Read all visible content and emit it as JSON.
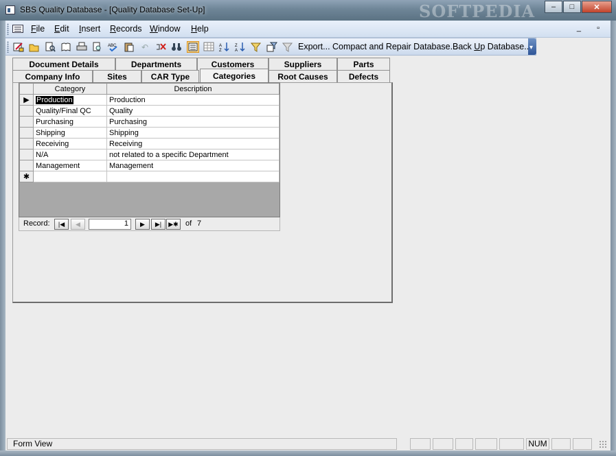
{
  "window": {
    "title": "SBS Quality Database - [Quality Database Set-Up]",
    "watermark": "SOFTPEDIA",
    "buttons": {
      "minimize": "–",
      "maximize": "□",
      "close": "✕"
    },
    "mdi_controls": "_ ▫"
  },
  "menubar": {
    "items": [
      {
        "label": "File",
        "accel": "F",
        "rest": "ile"
      },
      {
        "label": "Edit",
        "accel": "E",
        "rest": "dit"
      },
      {
        "label": "Insert",
        "accel": "I",
        "rest": "nsert"
      },
      {
        "label": "Records",
        "accel": "R",
        "rest": "ecords"
      },
      {
        "label": "Window",
        "accel": "W",
        "rest": "indow"
      },
      {
        "label": "Help",
        "accel": "H",
        "rest": "elp"
      }
    ]
  },
  "toolbar": {
    "icons": [
      "design-view-icon",
      "open-icon",
      "search-file-icon",
      "save-icon",
      "print-icon",
      "print-preview-icon",
      "spelling-icon",
      "paste-icon",
      "undo-icon",
      "delete-record-icon",
      "find-icon",
      "form-view-icon",
      "datasheet-view-icon",
      "sort-ascending-icon",
      "sort-descending-icon",
      "filter-by-selection-icon",
      "filter-by-form-icon",
      "apply-filter-icon"
    ],
    "export_label": "Export...",
    "compact_label": "Compact and Repair Database...",
    "backup_prefix": "Back",
    "backup_rest": " Up Database...",
    "backup_accel": "U"
  },
  "tabs": {
    "row1": [
      "Document Details",
      "Departments",
      "Customers",
      "Suppliers",
      "Parts"
    ],
    "row2": [
      "Company Info",
      "Sites",
      "CAR Type",
      "Categories",
      "Root Causes",
      "Defects"
    ],
    "selected": "Categories"
  },
  "datasheet": {
    "columns": [
      "Category",
      "Description"
    ],
    "rows": [
      {
        "category": "Production",
        "description": "Production"
      },
      {
        "category": "Quality/Final QC",
        "description": "Quality"
      },
      {
        "category": "Purchasing",
        "description": "Purchasing"
      },
      {
        "category": "Shipping",
        "description": "Shipping"
      },
      {
        "category": "Receiving",
        "description": "Receiving"
      },
      {
        "category": "N/A",
        "description": "not related to a specific Department"
      },
      {
        "category": "Management",
        "description": "Management"
      }
    ],
    "new_row_marker": "✱",
    "current_row_marker": "▶"
  },
  "record_nav": {
    "label": "Record:",
    "current": "1",
    "of_label": "of",
    "total": "7"
  },
  "statusbar": {
    "text": "Form View",
    "num": "NUM"
  }
}
